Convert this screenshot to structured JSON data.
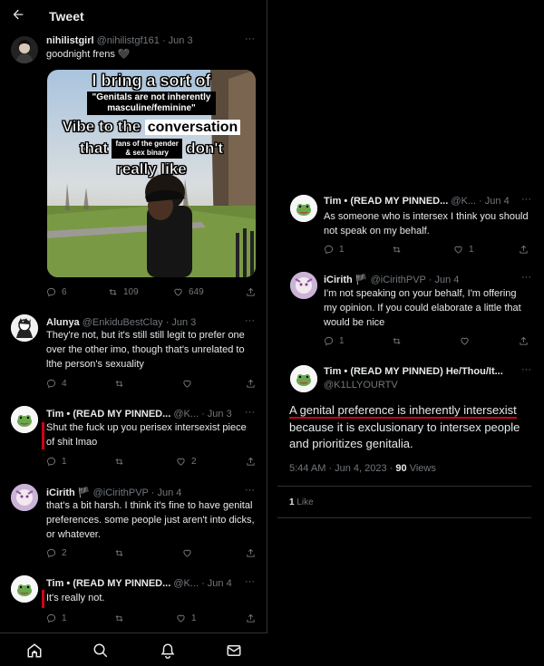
{
  "header": {
    "back_icon": "arrow-left-icon",
    "title": "Tweet"
  },
  "tweets_left": [
    {
      "name": "nihilistgirl",
      "handle": "@nihilistgf161 · Jun 3",
      "text": "goodnight frens 🖤",
      "media": {
        "line1": "I bring a sort of",
        "line2a": "\"Genitals are not inherently",
        "line2b": "masculine/feminine\"",
        "line3a": "Vibe to the",
        "line3b": "conversation",
        "line4a": "that",
        "line4b": "fans of the gender",
        "line4c": "& sex binary",
        "line4d": "don't",
        "line5": "really like"
      },
      "replies": "6",
      "retweets": "109",
      "likes": "649"
    },
    {
      "name": "Alunya",
      "handle": "@EnkiduBestClay · Jun 3",
      "text": "They're not, but it's still still legit to prefer one over the other imo, though that's unrelated to lthe person's sexuality",
      "replies": "4",
      "retweets": "",
      "likes": ""
    },
    {
      "name": "Tim • (READ MY PINNED...",
      "handle": "@K... · Jun 3",
      "text": "Shut the fuck up you perisex intersexist piece of shit lmao",
      "replies": "1",
      "retweets": "",
      "likes": "2"
    },
    {
      "name": "iCirith",
      "handle": "@iCirithPVP · Jun 4",
      "text": "that's a bit harsh. I think it's fine to have genital preferences. some people just aren't into dicks, or whatever.",
      "replies": "2",
      "retweets": "",
      "likes": ""
    },
    {
      "name": "Tim • (READ MY PINNED...",
      "handle": "@K... · Jun 4",
      "text": "It's really not.",
      "replies": "1",
      "retweets": "",
      "likes": "1"
    }
  ],
  "tweets_right": [
    {
      "name": "Tim • (READ MY PINNED...",
      "handle": "@K... · Jun 4",
      "text": "As someone who is intersex I think you should not speak on my behalf.",
      "replies": "1",
      "retweets": "",
      "likes": "1"
    },
    {
      "name": "iCirith",
      "handle": "@iCirithPVP · Jun 4",
      "text": "I'm not speaking on your behalf, I'm offering my opinion. If you could elaborate a little that would be nice",
      "replies": "1",
      "retweets": "",
      "likes": ""
    }
  ],
  "main_tweet": {
    "name": "Tim • (READ MY PINNED) He/Thou/It...",
    "handle": "@K1LLYOURTV",
    "text_line1": "A genital preference is inherently intersexist",
    "text_line2": "because it is exclusionary to intersex people",
    "text_line3": "and prioritizes genitalia.",
    "timestamp": "5:44 AM · Jun 4, 2023 · ",
    "views_count": "90",
    "views_label": " Views",
    "likes_count": "1",
    "likes_label": " Like"
  },
  "tabbar": [
    "home-icon",
    "search-icon",
    "notifications-icon",
    "messages-icon"
  ],
  "colors": {
    "background": "#000000",
    "text": "#e7e9ea",
    "muted": "#71767b",
    "divider": "#2f3336",
    "annotation_red": "#d0021b"
  }
}
